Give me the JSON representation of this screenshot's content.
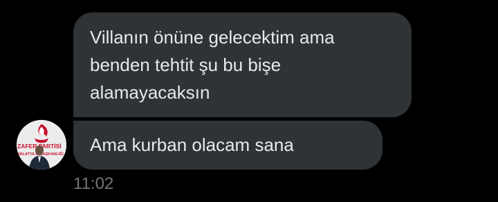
{
  "messages": [
    {
      "lines": [
        "Villanın önüne gelecektim ama",
        "benden tehtit şu bu bişe",
        "alamayacaksın"
      ]
    },
    {
      "lines": [
        "Ama kurban olacam sana"
      ]
    }
  ],
  "timestamp": "11:02",
  "avatar": {
    "text_top": "ZAFER PARTİSİ",
    "text_bottom": "MALATYA İL BAŞKANLIĞI",
    "brand_color": "#c8102e"
  }
}
